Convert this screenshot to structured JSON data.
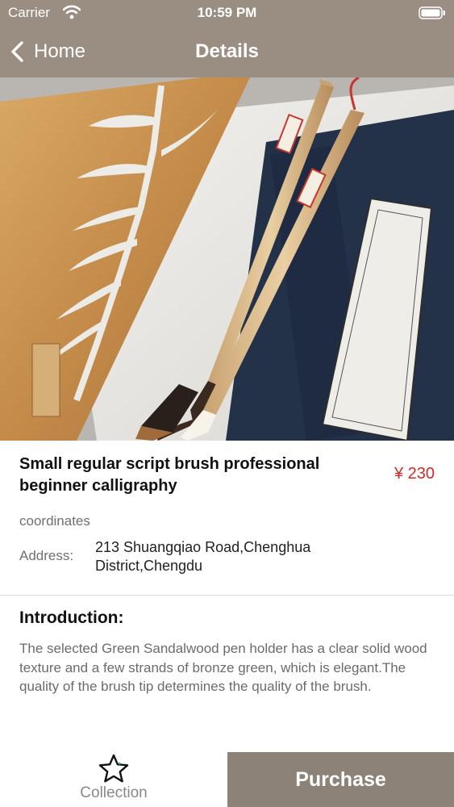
{
  "status_bar": {
    "carrier": "Carrier",
    "time": "10:59 PM"
  },
  "nav": {
    "back_label": "Home",
    "title": "Details"
  },
  "product": {
    "title": "Small regular script brush professional beginner calligraphy",
    "price": "¥ 230",
    "coordinates_label": "coordinates",
    "address_label": "Address:",
    "address": "213 Shuangqiao Road,Chenghua District,Chengdu"
  },
  "introduction": {
    "heading": "Introduction:",
    "text": "The selected Green Sandalwood pen holder has a clear solid wood texture and a few strands of bronze green, which is elegant.The quality of the brush tip determines the quality of the brush."
  },
  "actions": {
    "collection_label": "Collection",
    "purchase_label": "Purchase"
  },
  "colors": {
    "nav": "#9a8e82",
    "purchase": "#8c8277",
    "price": "#d12a2a"
  }
}
